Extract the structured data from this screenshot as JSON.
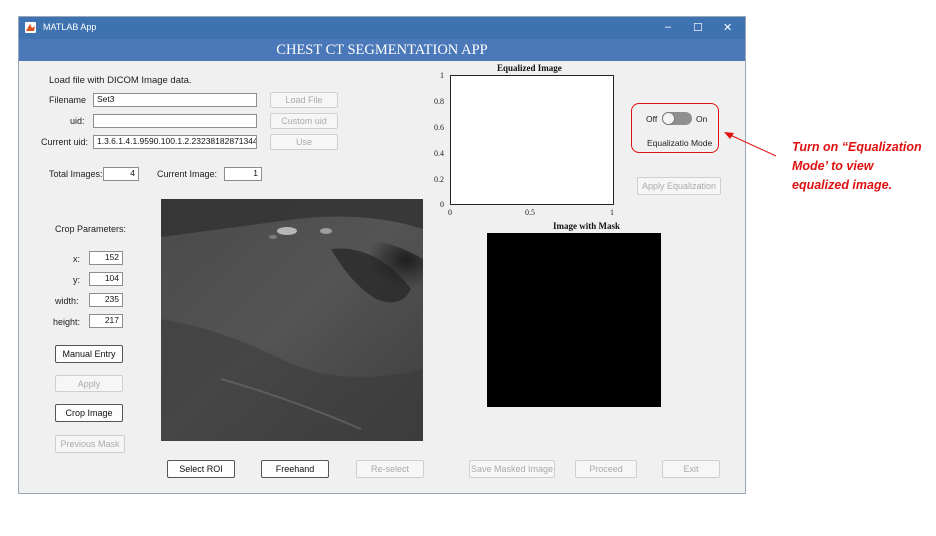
{
  "window": {
    "title": "MATLAB App",
    "controls": [
      "–",
      "☐",
      "✕"
    ]
  },
  "app": {
    "header": "CHEST CT SEGMENTATION APP"
  },
  "load": {
    "instruction": "Load file with DICOM Image data.",
    "filename_label": "Filename",
    "filename_value": "Set3",
    "uid_label": "uid:",
    "uid_value": "",
    "current_uid_label": "Current uid:",
    "current_uid_value": "1.3.6.1.4.1.9590.100.1.2.23238182871344",
    "load_file_button": "Load File",
    "custom_uid_button": "Custom uid",
    "use_button": "Use"
  },
  "counts": {
    "total_label": "Total Images:",
    "total_value": "4",
    "current_label": "Current Image:",
    "current_value": "1"
  },
  "crop": {
    "title": "Crop Parameters:",
    "x_label": "x:",
    "x_value": "152",
    "y_label": "y:",
    "y_value": "104",
    "width_label": "width:",
    "width_value": "235",
    "height_label": "height:",
    "height_value": "217",
    "manual_entry_button": "Manual Entry",
    "apply_button": "Apply",
    "crop_image_button": "Crop Image",
    "previous_mask_button": "Previous Mask"
  },
  "roi": {
    "select_roi_button": "Select ROI",
    "freehand_button": "Freehand",
    "reselect_button": "Re-select"
  },
  "plot_equalized": {
    "title": "Equalized Image",
    "y_ticks": [
      "1",
      "0.8",
      "0.6",
      "0.4",
      "0.2",
      "0"
    ],
    "x_ticks": [
      "0",
      "0.5",
      "1"
    ]
  },
  "plot_mask": {
    "title": "Image with Mask"
  },
  "equalization": {
    "off_label": "Off",
    "on_label": "On",
    "switch_label": "Equalizatio Mode",
    "apply_button": "Apply Equalization"
  },
  "actions": {
    "save_masked_button": "Save Masked Image",
    "proceed_button": "Proceed",
    "exit_button": "Exit"
  },
  "annotation": {
    "line1": "Turn on “Equalization",
    "line2": "Mode’ to view",
    "line3": "equalized image.",
    "color": "#e01010"
  },
  "colors": {
    "titlebar": "#3f72b0",
    "header": "#4a78b8",
    "annotation": "#e01010"
  }
}
